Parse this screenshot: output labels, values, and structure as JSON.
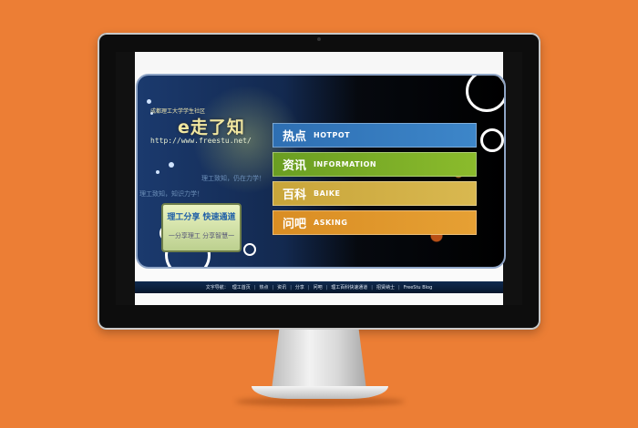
{
  "site": {
    "school": "成都理工大学学生社区",
    "logo": "e走了知",
    "url": "http://www.freestu.net/",
    "slogan_right": "理工致知，仍在力学！",
    "slogan_left": "理工致知，知识力学！",
    "share_title": "理工分享 快速通道",
    "share_sub": "一分享理工 分享智慧一"
  },
  "menu": [
    {
      "zh": "热点",
      "en": "HOTPOT"
    },
    {
      "zh": "资讯",
      "en": "INFORMATION"
    },
    {
      "zh": "百科",
      "en": "BAIKE"
    },
    {
      "zh": "问吧",
      "en": "ASKING"
    }
  ],
  "footer": {
    "prefix": "文字导航：",
    "links": [
      "理工首页",
      "热点",
      "资讯",
      "分享",
      "问吧",
      "理工百科快速通道",
      "招贤纳士",
      "FreeStu Blog"
    ]
  },
  "colors": {
    "background": "#ec7e35",
    "hotpot": "#2e6fb3",
    "information": "#6a9e22",
    "baike": "#c8a53a",
    "asking": "#d98d23"
  }
}
